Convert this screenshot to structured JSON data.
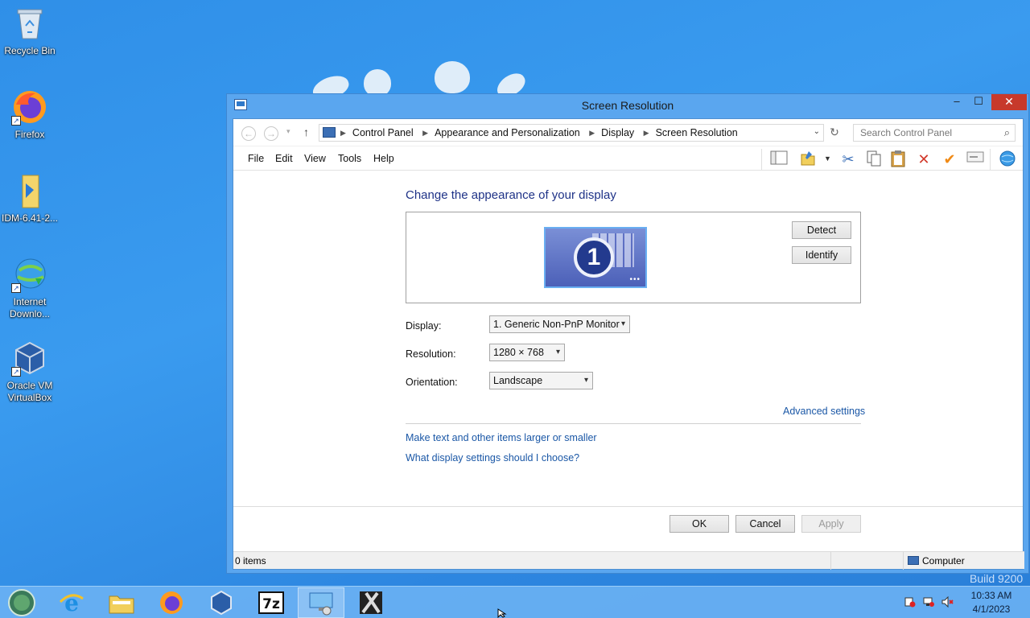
{
  "desktop": {
    "icons": [
      {
        "label": "Recycle Bin"
      },
      {
        "label": "Firefox"
      },
      {
        "label": "IDM-6.41-2..."
      },
      {
        "label": "Internet Downlo..."
      },
      {
        "label": "Oracle VM VirtualBox"
      }
    ],
    "build_text": "Build 9200"
  },
  "window": {
    "title": "Screen Resolution",
    "controls": {
      "minimize": "–",
      "maximize": "☐",
      "close": "✕"
    },
    "address": {
      "breadcrumbs": [
        "Control Panel",
        "Appearance and Personalization",
        "Display",
        "Screen Resolution"
      ],
      "search_placeholder": "Search Control Panel"
    },
    "menu": [
      "File",
      "Edit",
      "View",
      "Tools",
      "Help"
    ],
    "content": {
      "heading": "Change the appearance of your display",
      "monitor_number": "1",
      "detect_label": "Detect",
      "identify_label": "Identify",
      "display_label": "Display:",
      "display_value": "1. Generic Non-PnP Monitor",
      "resolution_label": "Resolution:",
      "resolution_value": "1280 × 768",
      "orientation_label": "Orientation:",
      "orientation_value": "Landscape",
      "advanced_link": "Advanced settings",
      "link_text_size": "Make text and other items larger or smaller",
      "link_choose": "What display settings should I choose?",
      "ok_label": "OK",
      "cancel_label": "Cancel",
      "apply_label": "Apply"
    },
    "status": {
      "items": "0 items",
      "location": "Computer"
    }
  },
  "taskbar": {
    "time": "10:33 AM",
    "date": "4/1/2023"
  },
  "colors": {
    "desktop": "#2f8fe8",
    "window_frame": "#5aa6ef",
    "close_button": "#c7392b",
    "heading": "#1e3287",
    "link": "#1a57a6"
  }
}
